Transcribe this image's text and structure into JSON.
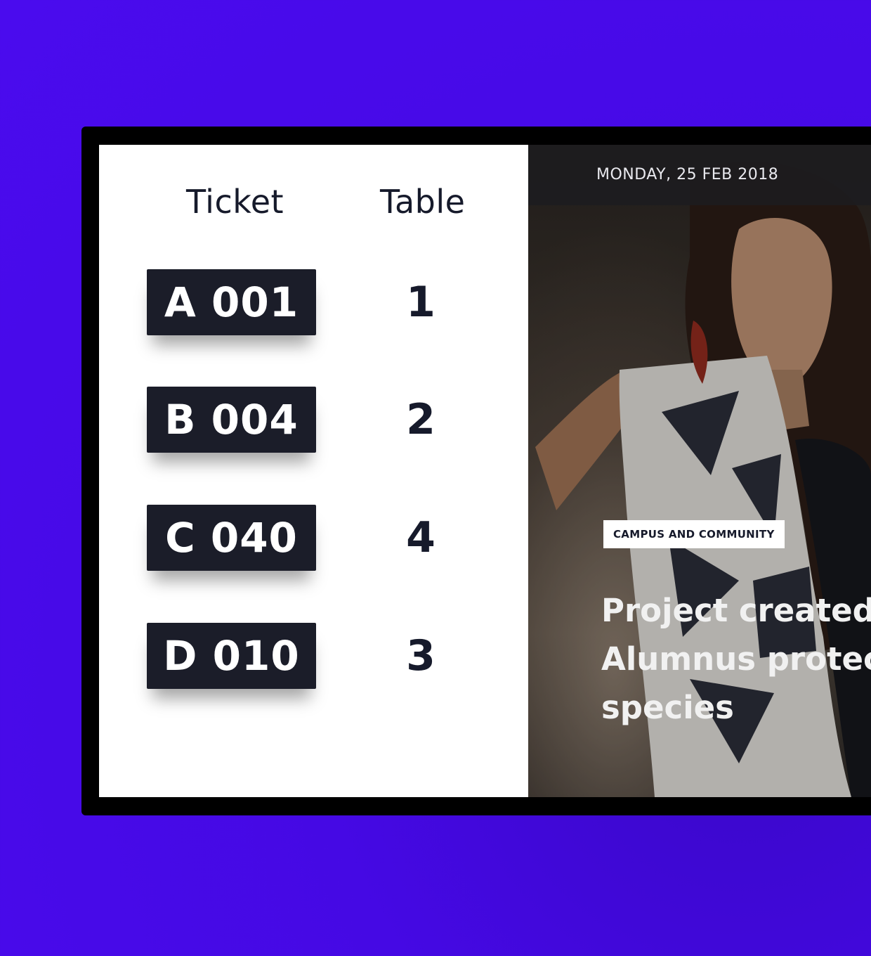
{
  "queue": {
    "headers": {
      "ticket": "Ticket",
      "table": "Table"
    },
    "rows": [
      {
        "ticket": "A 001",
        "table": "1"
      },
      {
        "ticket": "B 004",
        "table": "2"
      },
      {
        "ticket": "C 040",
        "table": "4"
      },
      {
        "ticket": "D 010",
        "table": "3"
      }
    ]
  },
  "news": {
    "date": "MONDAY, 25 FEB 2018",
    "category": "CAMPUS AND COMMUNITY",
    "headline_lines": [
      "Project created b",
      "Alumnus protect",
      "species"
    ]
  },
  "colors": {
    "background": "#4a0bee",
    "badge": "#1b1d29",
    "text_dark": "#161a2b"
  }
}
